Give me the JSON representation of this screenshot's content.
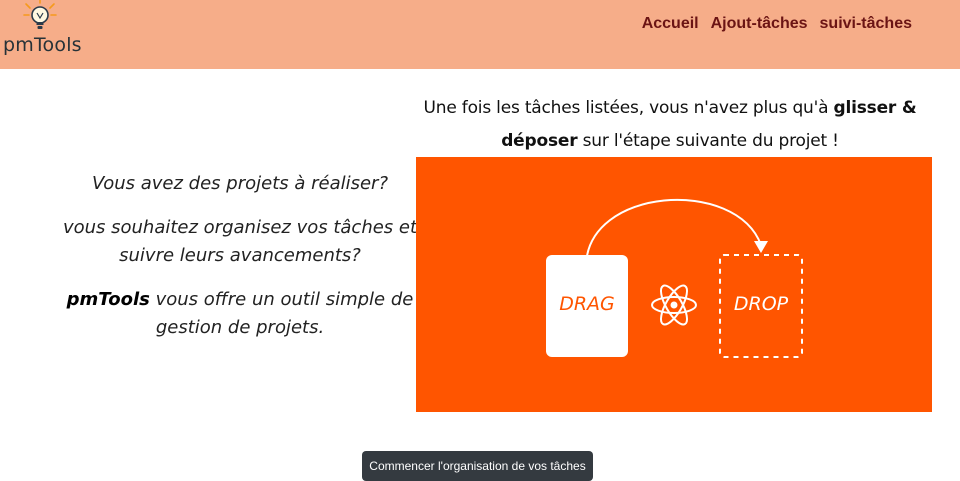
{
  "app": {
    "name": "pmTools"
  },
  "nav": {
    "items": [
      "Accueil",
      "Ajout-tâches",
      "suivi-tâches"
    ]
  },
  "intro": {
    "line1": "Vous avez des projets à réaliser?",
    "line2": "vous souhaitez organisez vos tâches et suivre leurs avancements?",
    "brand": "pmTools",
    "line3_rest": " vous offre un outil simple de gestion de projets."
  },
  "caption": {
    "part1": "Une fois les tâches listées, vous n'avez plus qu'à ",
    "bold1": "glisser &",
    "bold2": "déposer",
    "part2": " sur l'étape suivante du projet !"
  },
  "banner": {
    "drag_label": "DRAG",
    "drop_label": "DROP",
    "background": "#ff5500",
    "icon": "react-atom-icon"
  },
  "cta": {
    "label": "Commencer l'organisation de vos tâches"
  },
  "colors": {
    "header_bg": "#f6ad89",
    "nav_link": "#6b1414",
    "button_bg": "#343a40"
  }
}
